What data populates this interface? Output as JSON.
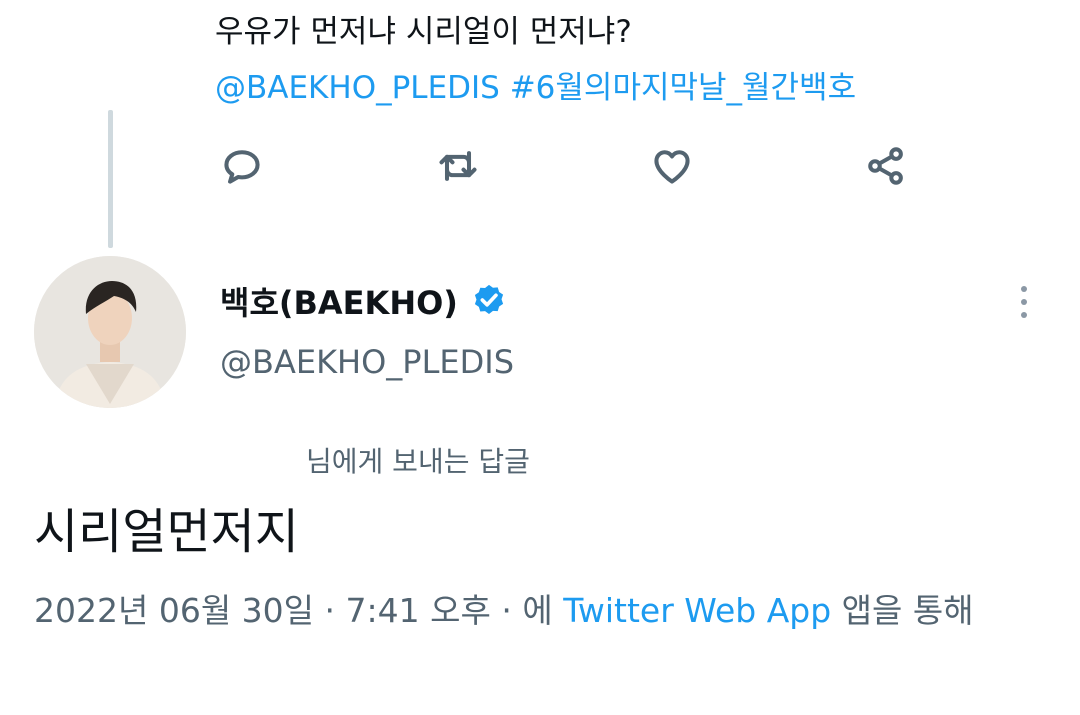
{
  "previous_tweet": {
    "text": "우유가 먼저냐 시리얼이 먼저냐?",
    "mention": "@BAEKHO_PLEDIS",
    "hashtag": "#6월의마지막날_월간백호"
  },
  "actions": {
    "icons": [
      "reply-icon",
      "retweet-icon",
      "like-icon",
      "share-icon"
    ]
  },
  "reply": {
    "display_name": "백호(BAEKHO)",
    "handle": "@BAEKHO_PLEDIS",
    "replying_to": "님에게 보내는 답글",
    "text": "시리얼먼저지",
    "date": "2022년 06월 30일",
    "sep1": " · ",
    "time": "7:41 오후",
    "sep2": " · ",
    "via_prefix": "에 ",
    "app": "Twitter Web App",
    "via_suffix": " 앱을 통해"
  },
  "colors": {
    "link": "#1d9bf0",
    "secondary": "#536471",
    "verified": "#1d9bf0"
  }
}
